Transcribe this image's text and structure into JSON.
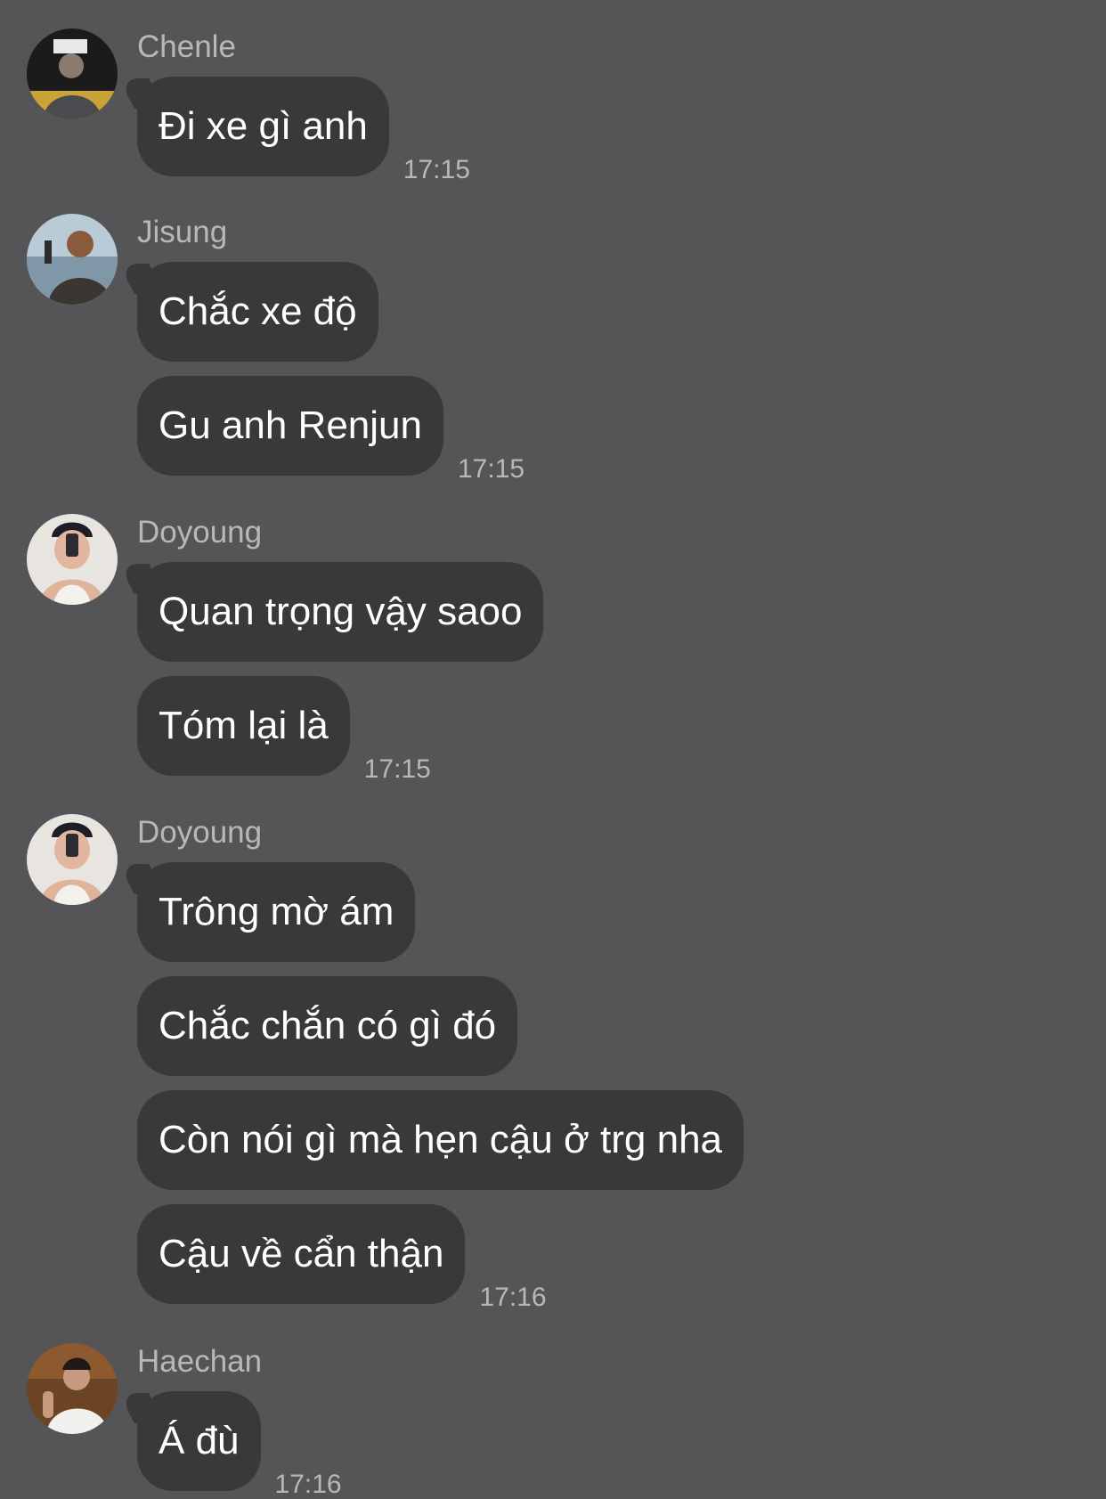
{
  "messages": [
    {
      "sender": "Chenle",
      "avatar_icon": "chenle-avatar-icon",
      "bubbles": [
        "Đi xe gì anh"
      ],
      "time": "17:15"
    },
    {
      "sender": "Jisung",
      "avatar_icon": "jisung-avatar-icon",
      "bubbles": [
        "Chắc xe độ",
        "Gu anh Renjun"
      ],
      "time": "17:15"
    },
    {
      "sender": "Doyoung",
      "avatar_icon": "doyoung-avatar-icon",
      "bubbles": [
        "Quan trọng vậy saoo",
        "Tóm lại là"
      ],
      "time": "17:15"
    },
    {
      "sender": "Doyoung",
      "avatar_icon": "doyoung-avatar-icon",
      "bubbles": [
        "Trông mờ ám",
        "Chắc chắn có gì đó",
        "Còn nói gì mà hẹn cậu ở trg nha",
        "Cậu về cẩn thận"
      ],
      "time": "17:16"
    },
    {
      "sender": "Haechan",
      "avatar_icon": "haechan-avatar-icon",
      "bubbles": [
        "Á đù"
      ],
      "time": "17:16"
    }
  ],
  "colors": {
    "background": "#555456",
    "bubble": "#39383a",
    "meta_text": "#b8b8bb",
    "message_text": "#ffffff"
  }
}
